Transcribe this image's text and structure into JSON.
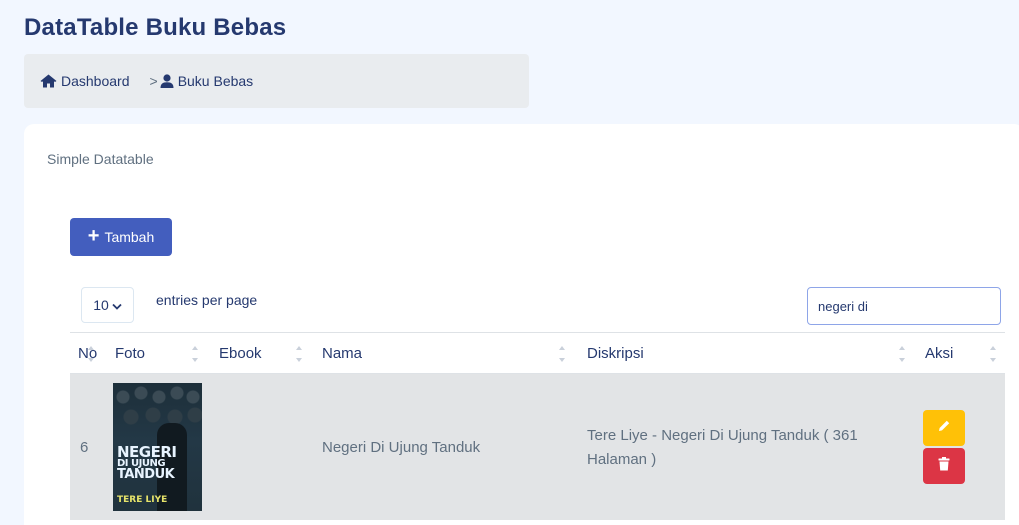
{
  "header": {
    "title": "DataTable Buku Bebas"
  },
  "breadcrumb": {
    "home_label": "Dashboard",
    "separator": ">",
    "current_label": "Buku Bebas"
  },
  "card": {
    "title": "Simple Datatable"
  },
  "toolbar": {
    "add_label": "Tambah"
  },
  "table_controls": {
    "per_page_value": "10",
    "per_page_label": "entries per page",
    "search_value": "negeri di"
  },
  "table": {
    "columns": [
      "No",
      "Foto",
      "Ebook",
      "Nama",
      "Diskripsi",
      "Aksi"
    ],
    "rows": [
      {
        "no": "6",
        "foto_cover": {
          "title_line1": "NEGERI",
          "title_line2": "DI UJUNG",
          "title_line3": "TANDUK",
          "author": "TERE LIYE"
        },
        "ebook": "",
        "nama": "Negeri Di Ujung Tanduk",
        "diskripsi_line1": "Tere Liye - Negeri Di Ujung Tanduk ( 361",
        "diskripsi_line2": "Halaman )"
      }
    ]
  },
  "icons": {
    "home": "home-icon",
    "user": "user-icon",
    "plus": "plus-icon",
    "chevron": "chevron-down-icon",
    "edit": "pencil-icon",
    "delete": "trash-icon"
  },
  "colors": {
    "primary": "#435ebe",
    "warning": "#ffc107",
    "danger": "#dc3545",
    "text": "#25396f",
    "row_bg": "#e2e4e6"
  }
}
